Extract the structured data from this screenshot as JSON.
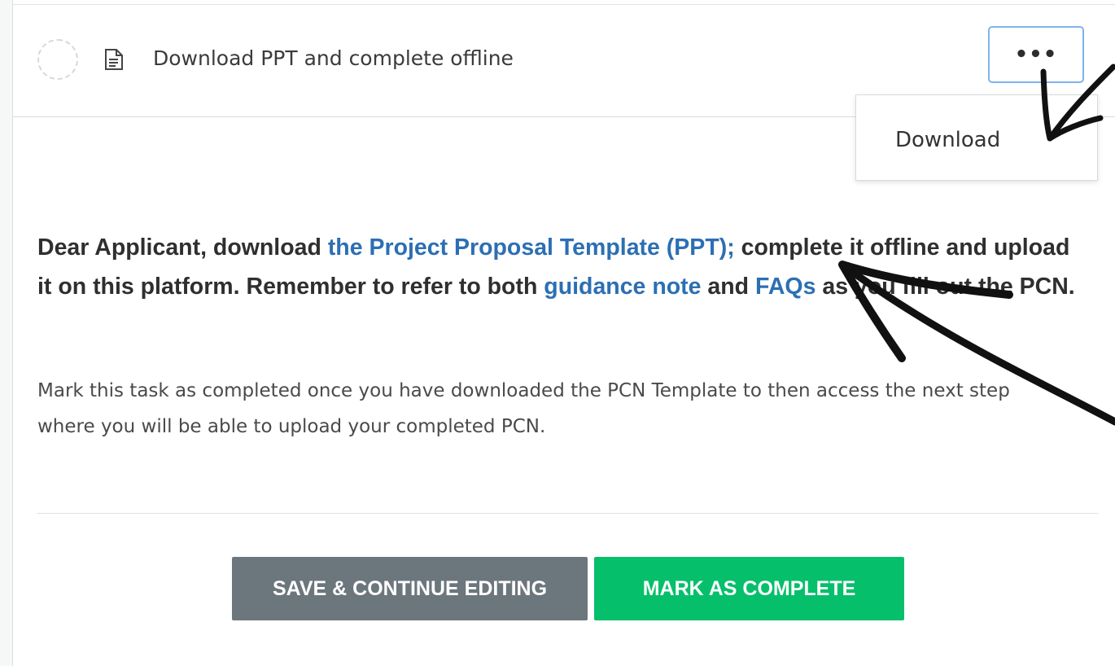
{
  "task": {
    "title": "Download PPT and complete offline",
    "more_button": "•••",
    "status_icon": "circle-dashed-icon",
    "type_icon": "document-icon"
  },
  "dropdown": {
    "items": [
      {
        "label": "Download"
      }
    ]
  },
  "content": {
    "intro": {
      "part1": "Dear Applicant, download ",
      "link_ppt": "the Project Proposal Template (PPT);",
      "part2": " complete it offline and upload it on this platform. Remember to refer to both ",
      "link_guidance": "guidance note",
      "part3": " and ",
      "link_faqs": "FAQs",
      "part4": " as you fill out the PCN."
    },
    "note": "Mark this task as completed once you have downloaded the PCN Template to then access the next step where you will be able to upload your completed PCN."
  },
  "actions": {
    "save_label": "SAVE & CONTINUE EDITING",
    "complete_label": "MARK AS COMPLETE"
  },
  "colors": {
    "link": "#2c6fb3",
    "save_button": "#6c767d",
    "complete_button": "#06bf6b",
    "more_button_border": "#7fb3ea",
    "annotation_arrows": "#111111"
  }
}
